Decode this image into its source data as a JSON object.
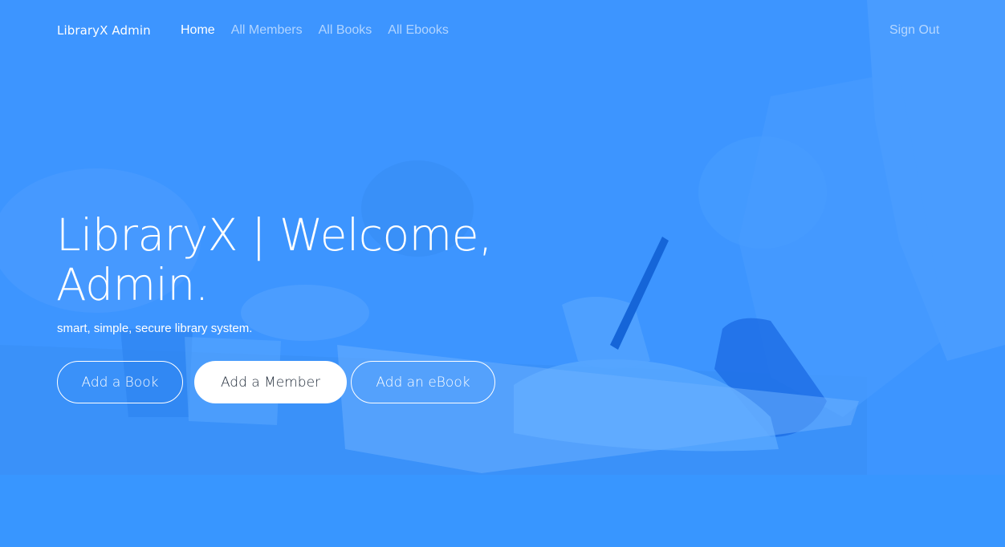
{
  "navbar": {
    "brand": "LibraryX Admin",
    "links": [
      {
        "label": "Home",
        "active": true
      },
      {
        "label": "All Members",
        "active": false
      },
      {
        "label": "All Books",
        "active": false
      },
      {
        "label": "All Ebooks",
        "active": false
      }
    ],
    "signout": "Sign Out"
  },
  "hero": {
    "title_line1": "LibraryX | Welcome,",
    "title_line2": "Admin.",
    "subtitle": "smart, simple, secure library system.",
    "buttons": {
      "add_book": "Add a Book",
      "add_member": "Add a Member",
      "add_ebook": "Add an eBook"
    }
  },
  "colors": {
    "overlay": "#3d95ff",
    "text": "#ffffff",
    "primary_button_bg": "#ffffff",
    "primary_button_text": "#1f2a38"
  }
}
